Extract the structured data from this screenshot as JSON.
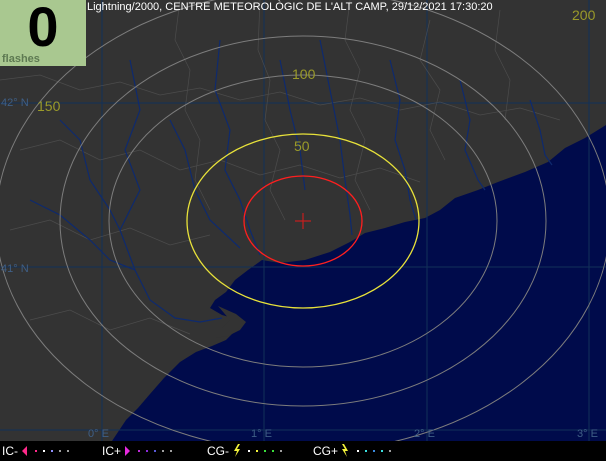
{
  "counter": {
    "value": "0",
    "unit": "flashes",
    "bg": "#a9c890"
  },
  "title": "Lightning/2000, CENTRE METEOROLÒGIC DE L'ALT CAMP, 29/12/2021 17:30:20",
  "range_labels": {
    "r50": "50",
    "r100": "100",
    "r150": "150",
    "r200": "200"
  },
  "grid_labels": {
    "lat_42": "42° N",
    "lat_41": "41° N",
    "lon_0": "0° E",
    "lon_1": "1° E",
    "lon_2": "2° E",
    "lon_3": "3° E"
  },
  "legend": {
    "ic_minus": {
      "label": "IC-",
      "color": "#ff2a8a"
    },
    "ic_plus": {
      "label": "IC+",
      "color": "#c02ad8"
    },
    "cg_minus": {
      "label": "CG-",
      "color": "#f2f23a"
    },
    "cg_plus": {
      "label": "CG+",
      "color": "#f2f23a"
    }
  },
  "colors": {
    "land": "#333333",
    "sea": "#000b4b",
    "ring_inner": "#ff1f1f",
    "ring_50": "#e8e23a",
    "ring_far": "#7d7d7d",
    "rivers": "#0e2a6e",
    "borders": "#6a6a6a",
    "graticule": "#123058"
  }
}
